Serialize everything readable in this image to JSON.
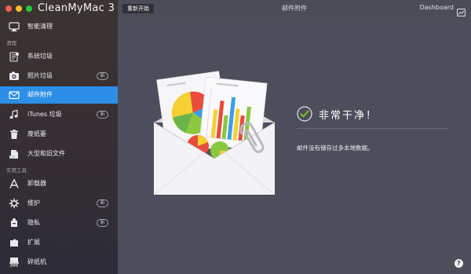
{
  "app": {
    "title": "CleanMyMac 3"
  },
  "sidebar": {
    "section_cleanup": "清理",
    "section_tools": "实用工具",
    "items": [
      {
        "label": "智能清理",
        "icon": "smart-cleanup-icon"
      },
      {
        "label": "系统垃圾",
        "icon": "system-junk-icon"
      },
      {
        "label": "照片垃圾",
        "icon": "photo-junk-icon",
        "badge": "新"
      },
      {
        "label": "邮件附件",
        "icon": "mail-icon",
        "active": true
      },
      {
        "label": "iTunes 垃圾",
        "icon": "itunes-icon",
        "badge": "新"
      },
      {
        "label": "废纸篓",
        "icon": "trash-icon"
      },
      {
        "label": "大型和旧文件",
        "icon": "large-files-icon"
      },
      {
        "label": "卸载器",
        "icon": "uninstaller-icon"
      },
      {
        "label": "维护",
        "icon": "maintenance-icon",
        "badge": "新"
      },
      {
        "label": "隐私",
        "icon": "privacy-icon",
        "badge": "新"
      },
      {
        "label": "扩展",
        "icon": "extensions-icon"
      },
      {
        "label": "碎纸机",
        "icon": "shredder-icon"
      }
    ]
  },
  "toolbar": {
    "restart_label": "重新开始",
    "page_title": "邮件附件",
    "dashboard_label": "Dashboard"
  },
  "status": {
    "title": "非常干净！",
    "description": "邮件没有储存过多本地数据。"
  },
  "help": {
    "label": "?"
  },
  "colors": {
    "accent": "#2c8ee6",
    "check": "#7ed321",
    "background": "#4d4e5b"
  }
}
